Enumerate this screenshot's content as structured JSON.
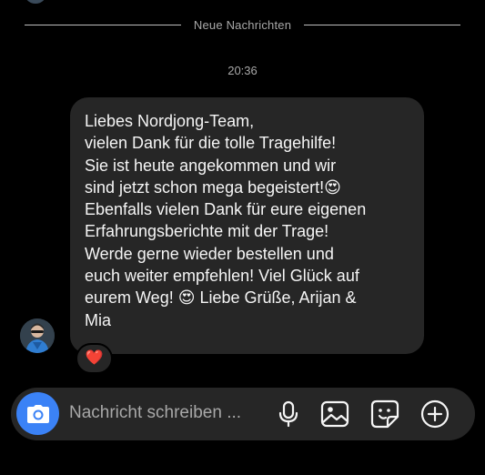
{
  "chat": {
    "divider_label": "Neue Nachrichten",
    "timestamp": "20:36",
    "message": {
      "text": "Liebes Nordjong-Team,\nvielen Dank für die tolle Tragehilfe!\nSie ist heute angekommen und wir\nsind jetzt schon mega begeistert!😍\nEbenfalls vielen Dank für eure eigenen\nErfahrungsberichte mit der Trage!\nWerde gerne wieder bestellen und\neuch weiter empfehlen! Viel Glück auf\neurem Weg! 😍 Liebe Grüße, Arijan &\nMia",
      "reaction": "❤️"
    }
  },
  "composer": {
    "placeholder": "Nachricht schreiben ...",
    "icons": [
      "camera-icon",
      "microphone-icon",
      "image-icon",
      "sticker-icon",
      "plus-icon"
    ]
  },
  "colors": {
    "background": "#000000",
    "bubble": "#262626",
    "accent": "#3b82f6",
    "muted_text": "#a8a8a8"
  }
}
